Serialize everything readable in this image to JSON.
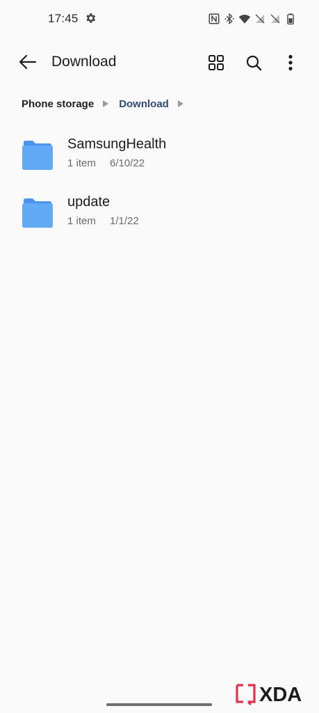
{
  "status_bar": {
    "time": "17:45",
    "icons": [
      "settings-icon",
      "nfc-icon",
      "bluetooth-icon",
      "wifi-icon",
      "no-sim-icon",
      "no-sim-2-icon",
      "battery-icon"
    ]
  },
  "app_bar": {
    "title": "Download",
    "icons": [
      "back-arrow-icon",
      "grid-view-icon",
      "search-icon",
      "more-vert-icon"
    ]
  },
  "breadcrumb": {
    "root": "Phone storage",
    "current": "Download"
  },
  "files": [
    {
      "name": "SamsungHealth",
      "count": "1 item",
      "date": "6/10/22",
      "icon": "folder-icon"
    },
    {
      "name": "update",
      "count": "1 item",
      "date": "1/1/22",
      "icon": "folder-icon"
    }
  ],
  "colors": {
    "background": "#fafafa",
    "folder": "#63aaf6",
    "folder_tab": "#4c95ea",
    "breadcrumb_current": "#2f4a74",
    "watermark_accent": "#e0334f"
  },
  "watermark": {
    "text": "XDA"
  }
}
